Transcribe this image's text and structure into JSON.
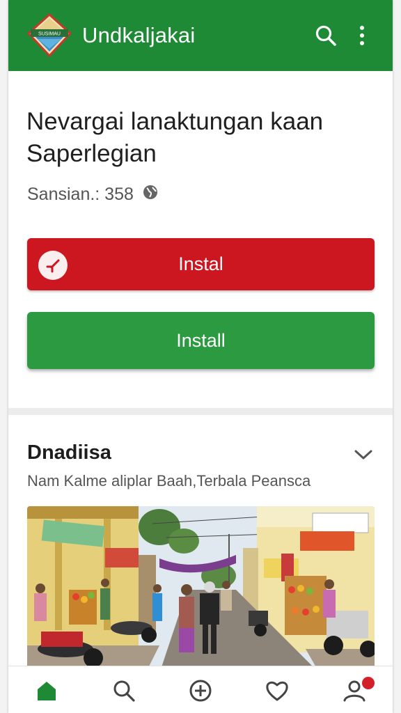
{
  "app_bar": {
    "title": "Undkaljakai",
    "logo_text": "SUSIMAU",
    "search_icon": "search-icon",
    "more_icon": "more-vert-icon",
    "bg_color": "#1f8a35"
  },
  "app_card": {
    "name": "Nevargai lanaktungan kaan Saperlegian",
    "meta_label": "Sansian.: 358",
    "meta_icon": "globe-icon",
    "primary_button_label": "Instal",
    "primary_button_icon": "shortcut-icon",
    "secondary_button_label": "Install",
    "primary_color": "#cc1720",
    "secondary_color": "#2b9a40"
  },
  "section": {
    "title": "Dnadiisa",
    "subtitle": "Nam Kalme aliplar Baah,Terbala Peansca",
    "expand_icon": "chevron-down-icon",
    "photo_sign_left": "",
    "photo_sign_right": ""
  },
  "bottom_nav": {
    "items": [
      {
        "label": "",
        "icon": "home-icon",
        "active": true
      },
      {
        "label": "",
        "icon": "search-icon"
      },
      {
        "label": "",
        "icon": "add-circle-icon"
      },
      {
        "label": "",
        "icon": "heart-icon"
      },
      {
        "label": "",
        "icon": "person-icon"
      }
    ],
    "badge_count": ""
  }
}
